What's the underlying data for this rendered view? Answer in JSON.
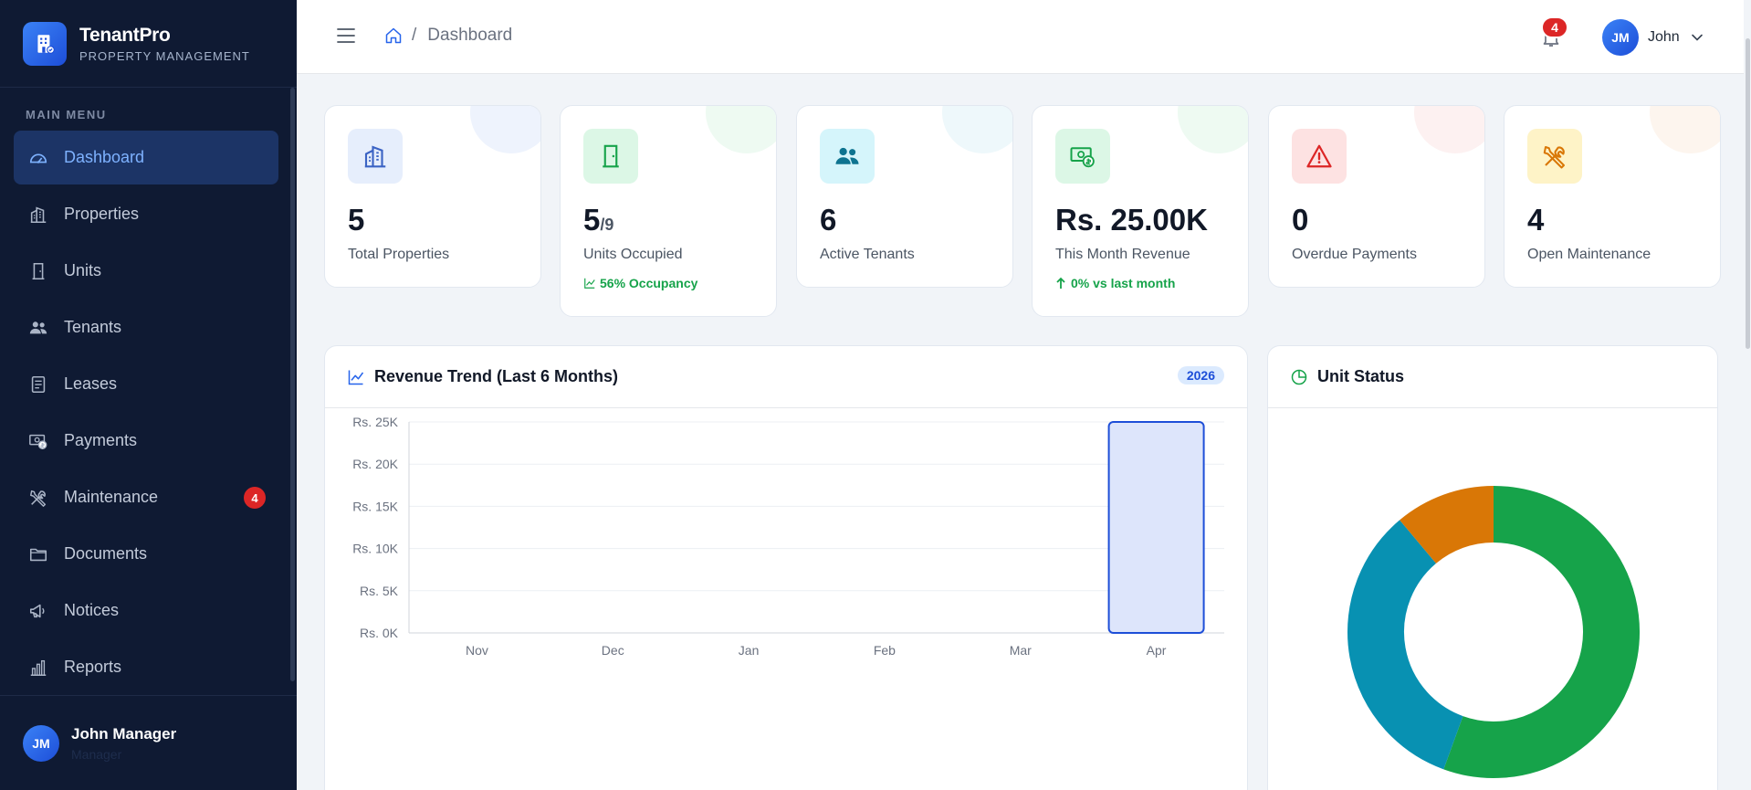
{
  "brand": {
    "name": "TenantPro",
    "subtitle": "PROPERTY MANAGEMENT"
  },
  "menu": {
    "heading": "MAIN MENU",
    "items": [
      {
        "label": "Dashboard",
        "icon": "dashboard-gauge-icon",
        "active": true
      },
      {
        "label": "Properties",
        "icon": "building-icon"
      },
      {
        "label": "Units",
        "icon": "door-icon"
      },
      {
        "label": "Tenants",
        "icon": "users-icon"
      },
      {
        "label": "Leases",
        "icon": "document-icon"
      },
      {
        "label": "Payments",
        "icon": "cash-icon"
      },
      {
        "label": "Maintenance",
        "icon": "tools-icon",
        "badge": "4"
      },
      {
        "label": "Documents",
        "icon": "folder-icon"
      },
      {
        "label": "Notices",
        "icon": "megaphone-icon"
      },
      {
        "label": "Reports",
        "icon": "bar-chart-icon"
      }
    ]
  },
  "sidebar_user": {
    "initials": "JM",
    "name": "John Manager",
    "role": "Manager"
  },
  "topbar": {
    "breadcrumb": "Dashboard",
    "notification_count": "4",
    "user_initials": "JM",
    "user_name": "John"
  },
  "stats": [
    {
      "value": "5",
      "label": "Total Properties",
      "icon": "building-icon",
      "color": "#3b63c4",
      "bg": "#e6eefc",
      "deco": "#eef3fd"
    },
    {
      "value": "5",
      "suffix": "/9",
      "label": "Units Occupied",
      "trend": "56% Occupancy",
      "icon": "door-icon",
      "color": "#16a34a",
      "bg": "#dcf7e6",
      "deco": "#eefaf2"
    },
    {
      "value": "6",
      "label": "Active Tenants",
      "icon": "users-icon",
      "color": "#0e7490",
      "bg": "#d5f5fb",
      "deco": "#eef8fb"
    },
    {
      "value": "Rs. 25.00K",
      "label": "This Month Revenue",
      "trend": "0% vs last month",
      "icon": "cash-icon",
      "color": "#16a34a",
      "bg": "#dcf7e6",
      "deco": "#eefaf2"
    },
    {
      "value": "0",
      "label": "Overdue Payments",
      "icon": "warning-icon",
      "color": "#dc2626",
      "bg": "#fde2e2",
      "deco": "#fdf1f1"
    },
    {
      "value": "4",
      "label": "Open Maintenance",
      "icon": "tools-icon",
      "color": "#d97706",
      "bg": "#fef3c7",
      "deco": "#fdf5ee"
    }
  ],
  "revenue_card": {
    "title": "Revenue Trend (Last 6 Months)",
    "year": "2026"
  },
  "status_card": {
    "title": "Unit Status"
  },
  "chart_data": [
    {
      "type": "bar",
      "title": "Revenue Trend (Last 6 Months)",
      "categories": [
        "Nov",
        "Dec",
        "Jan",
        "Feb",
        "Mar",
        "Apr"
      ],
      "values": [
        0,
        0,
        0,
        0,
        0,
        25000
      ],
      "ylim": [
        0,
        25000
      ],
      "yticks": [
        "Rs. 0K",
        "Rs. 5K",
        "Rs. 10K",
        "Rs. 15K",
        "Rs. 20K",
        "Rs. 25K"
      ],
      "bar_fill": "#dde5fb",
      "bar_stroke": "#1d4ed8",
      "grid": true
    },
    {
      "type": "pie",
      "title": "Unit Status",
      "values": [
        5,
        3,
        1
      ],
      "colors": [
        "#16a34a",
        "#0891b2",
        "#d97706"
      ]
    }
  ]
}
